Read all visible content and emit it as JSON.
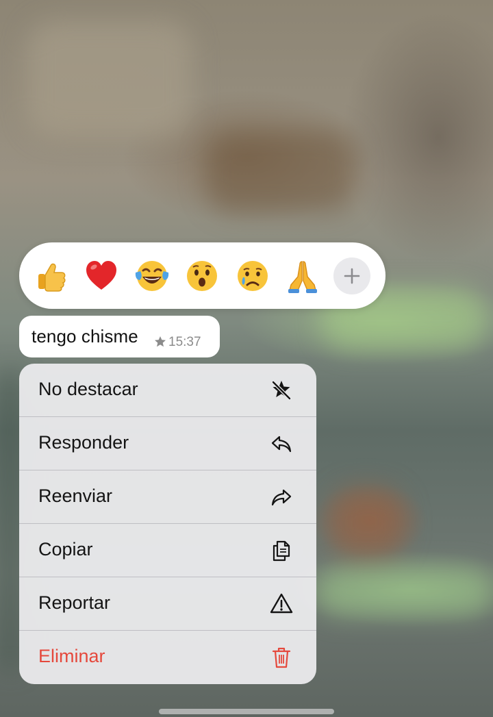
{
  "reactions": [
    {
      "name": "thumbs-up-emoji"
    },
    {
      "name": "red-heart-emoji"
    },
    {
      "name": "tears-of-joy-emoji"
    },
    {
      "name": "surprised-emoji"
    },
    {
      "name": "crying-emoji"
    },
    {
      "name": "folded-hands-emoji"
    }
  ],
  "reaction_add_icon": "plus-icon",
  "message": {
    "text": "tengo chisme",
    "time": "15:37",
    "starred_icon": "star-icon"
  },
  "menu": {
    "items": [
      {
        "label": "No destacar",
        "icon": "unstar-icon"
      },
      {
        "label": "Responder",
        "icon": "reply-icon"
      },
      {
        "label": "Reenviar",
        "icon": "forward-icon"
      },
      {
        "label": "Copiar",
        "icon": "copy-icon"
      },
      {
        "label": "Reportar",
        "icon": "warning-icon"
      },
      {
        "label": "Eliminar",
        "icon": "trash-icon"
      }
    ]
  },
  "colors": {
    "danger": "#e5483c",
    "menu_bg": "#ececee"
  }
}
